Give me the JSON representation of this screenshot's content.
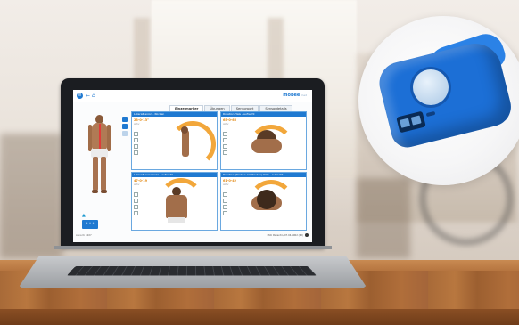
{
  "app": {
    "brand": "mobee",
    "brand_suffix": "med",
    "tabs": [
      "Einzelmarker",
      "Übungen",
      "Sensorport",
      "Sensordetails"
    ],
    "menu_icon": "menu-icon",
    "back_icon": "back-arrow-icon",
    "home_icon": "home-icon"
  },
  "cards": [
    {
      "title": "Lateralflexion - Rücken",
      "value": "23-0-13°",
      "sub": "aktiv"
    },
    {
      "title": "Rotation Hals - aufrecht",
      "value": "65-0-65",
      "sub": "aktiv"
    },
    {
      "title": "Lateralflexion links - aufrecht",
      "value": "47-0-19",
      "sub": "aktiv"
    },
    {
      "title": "Rotation (Drehen am Rücken) Hals - aufrecht",
      "value": "61-0-42",
      "sub": "aktiv"
    }
  ],
  "footer": {
    "action_button": "•••",
    "left_text": "Anna N. 1927",
    "right_text": "Moti Patientin, 07.04.1962 (60)"
  },
  "colors": {
    "accent": "#1f79d1",
    "value": "#e28a17",
    "sensor": "#1c6fd6"
  }
}
